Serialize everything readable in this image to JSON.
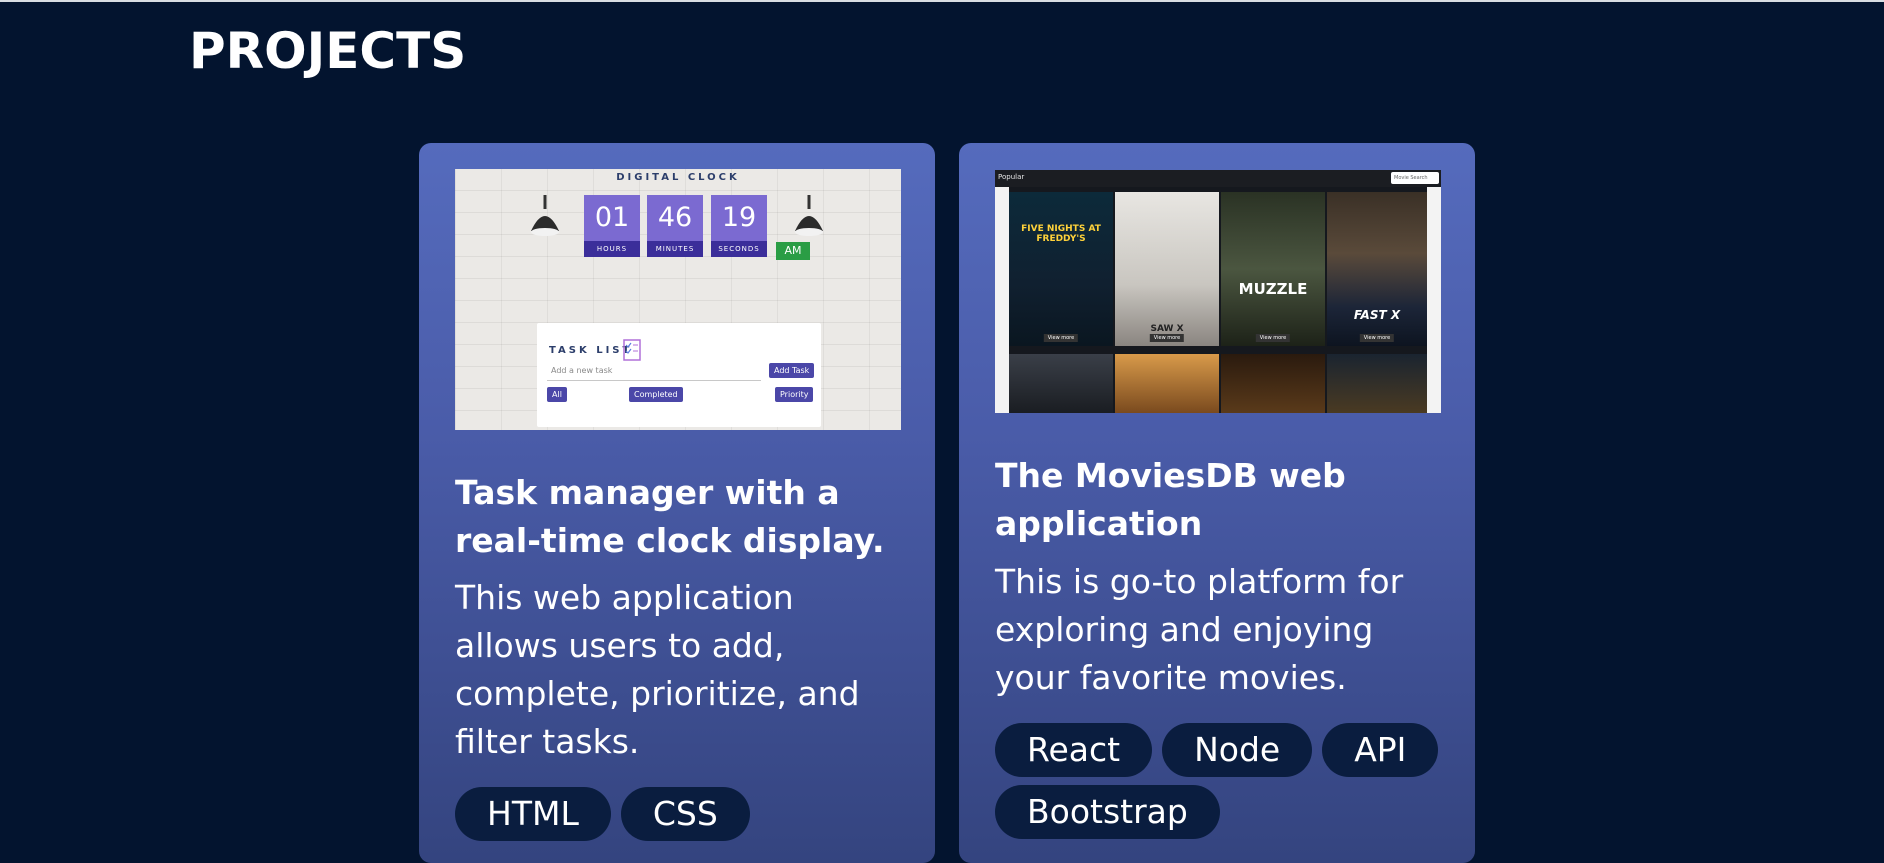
{
  "section": {
    "title": "PROJECTS"
  },
  "projects": [
    {
      "title": "Task manager with a real-time clock display.",
      "description": "This web application allows users to add, complete, prioritize, and filter tasks.",
      "tags": [
        "HTML",
        "CSS"
      ],
      "thumbnail": {
        "clock_title": "DIGITAL CLOCK",
        "hours": "01",
        "minutes": "46",
        "seconds": "19",
        "hours_label": "HOURS",
        "minutes_label": "MINUTES",
        "seconds_label": "SECONDS",
        "ampm": "AM",
        "task_list_title": "TASK LIST",
        "task_placeholder": "Add a new task",
        "add_task": "Add Task",
        "filter_all": "All",
        "filter_completed": "Completed",
        "filter_priority": "Priority"
      }
    },
    {
      "title": "The MoviesDB web application",
      "description": "This is go-to platform for exploring and enjoying your favorite movies.",
      "tags": [
        "React",
        "Node",
        "API",
        "Bootstrap"
      ],
      "thumbnail": {
        "popular": "Popular",
        "search_placeholder": "Movie Search",
        "view_more": "View more",
        "posters": [
          "FIVE NIGHTS AT FREDDY'S",
          "SAW X",
          "MUZZLE",
          "FAST X"
        ]
      }
    }
  ],
  "colors": {
    "page_bg": "#03142f",
    "card_top": "#556bbd",
    "card_bottom": "#34447f",
    "tag_bg": "#0a1d3f"
  }
}
